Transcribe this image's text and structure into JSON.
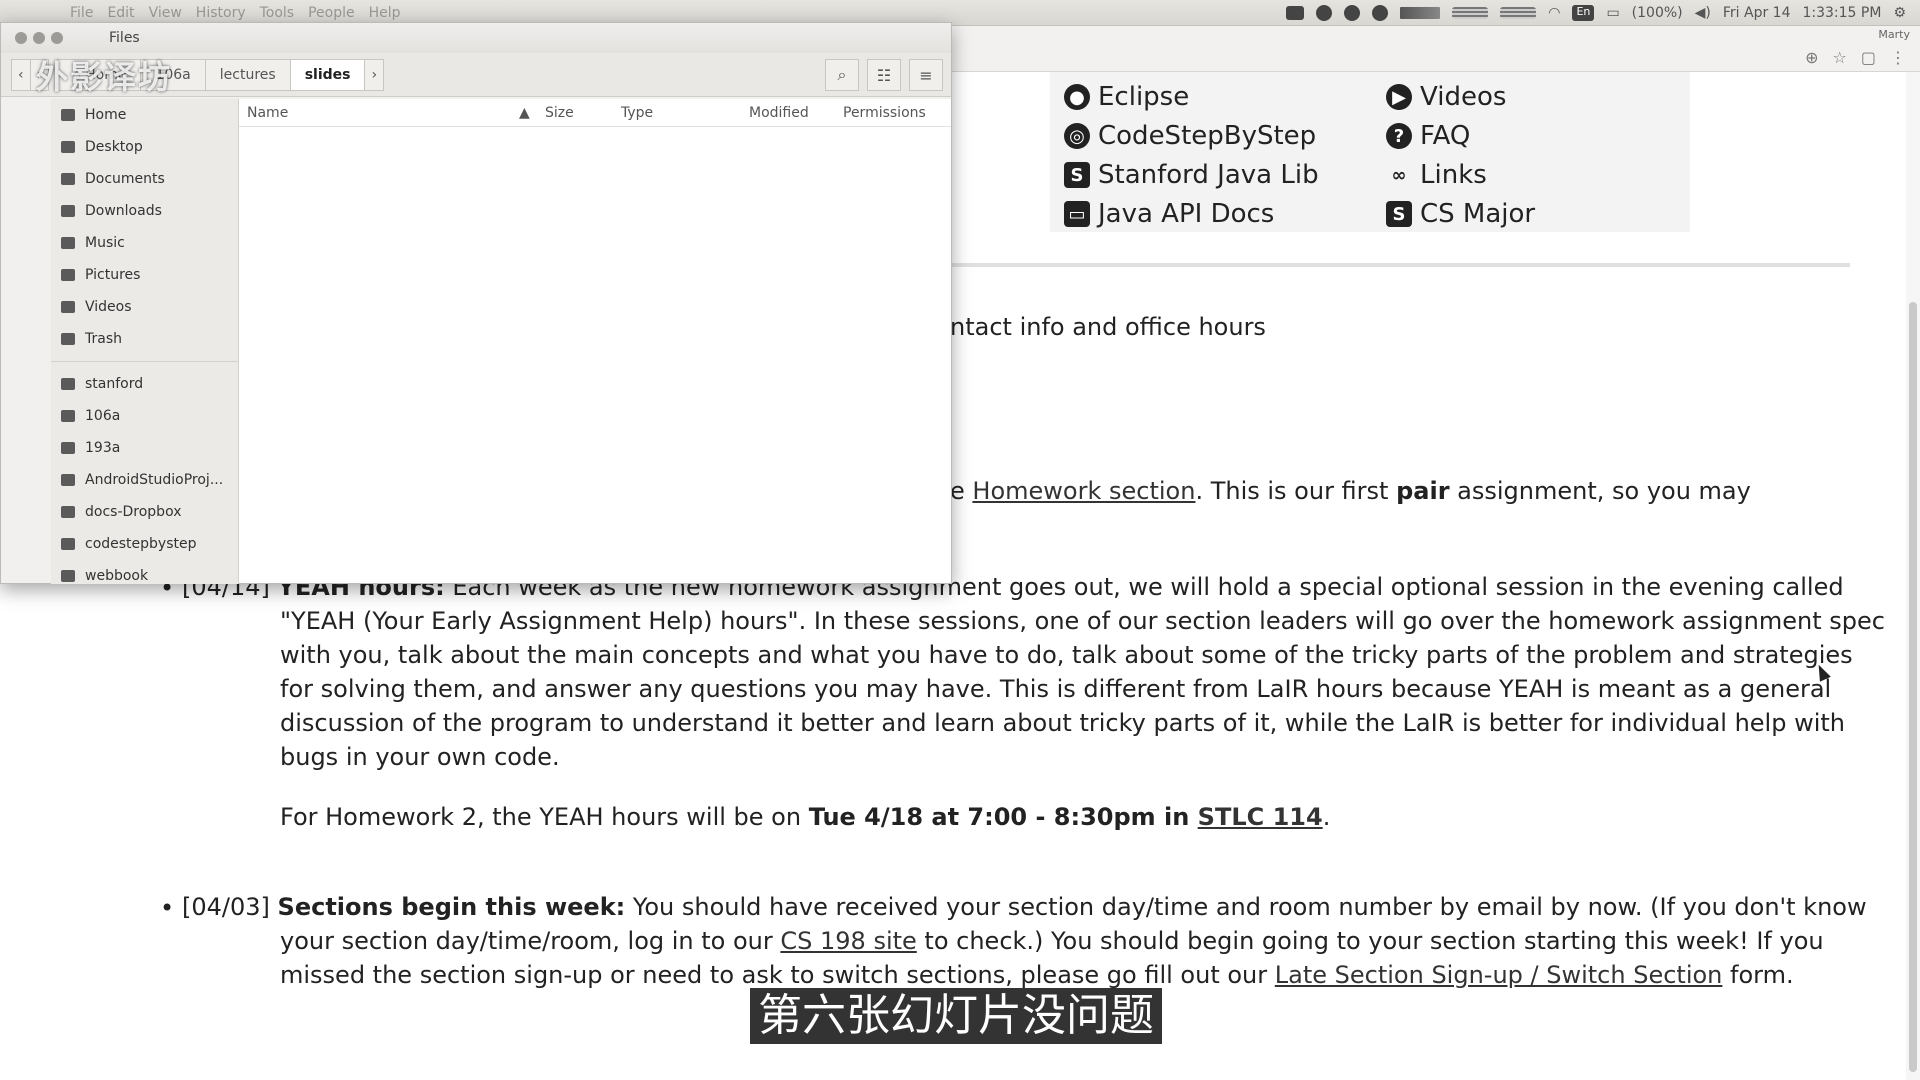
{
  "menubar": {
    "items": [
      "File",
      "Edit",
      "View",
      "History",
      "Tools",
      "People",
      "Help"
    ],
    "battery": "(100%)",
    "date": "Fri Apr 14",
    "time": "1:33:15 PM",
    "lang": "En"
  },
  "browser": {
    "user": "Marty"
  },
  "files": {
    "title": "Files",
    "breadcrumbs": [
      "Home",
      "106a",
      "lectures",
      "slides"
    ],
    "sidebar_places": [
      "Home",
      "Desktop",
      "Documents",
      "Downloads",
      "Music",
      "Pictures",
      "Videos",
      "Trash"
    ],
    "sidebar_bookmarks": [
      "stanford",
      "106a",
      "193a",
      "AndroidStudioProj...",
      "docs-Dropbox",
      "codestepbystep",
      "webbook"
    ],
    "columns": [
      "Name",
      "Size",
      "Type",
      "Modified",
      "Permissions"
    ]
  },
  "nav": {
    "left": [
      "Eclipse",
      "CodeStepByStep",
      "Stanford Java Lib",
      "Java API Docs"
    ],
    "right": [
      "Videos",
      "FAQ",
      "Links",
      "CS Major"
    ]
  },
  "content": {
    "contact_fragment": "ntact info and office hours",
    "hw_prefix": "e ",
    "hw_link": "Homework section",
    "hw_mid": ". This is our first ",
    "hw_bold": "pair",
    "hw_tail": " assignment, so you may",
    "yeah_date": "[04/14] ",
    "yeah_title": "YEAH hours:",
    "yeah_line1": " Each week as the new homework assignment goes out, we will hold a special optional session in the evening called",
    "yeah_line2": "\"YEAH (Your Early Assignment Help) hours\". In these sessions, one of our section leaders will go over the homework assignment spec",
    "yeah_line3": "with you, talk about the main concepts and what you have to do, talk about some of the tricky parts of the problem and strategies",
    "yeah_line4": "for solving them, and answer any questions you may have. This is different from LaIR hours because YEAH is meant as a general",
    "yeah_line5": "discussion of the program to understand it better and learn about tricky parts of it, while the LaIR is better for individual help with",
    "yeah_line6": "bugs in your own code.",
    "hw2_prefix": "For Homework 2, the YEAH hours will be on ",
    "hw2_bold": "Tue 4/18 at 7:00 - 8:30pm in ",
    "hw2_link": "STLC 114",
    "hw2_end": ".",
    "sec_date": "[04/03] ",
    "sec_title": "Sections begin this week:",
    "sec_line1": " You should have received your section day/time and room number by email by now. (If you don't know",
    "sec_line2a": "your section day/time/room, log in to our ",
    "sec_link1": "CS 198 site",
    "sec_line2b": " to check.) You should begin going to your section starting this week! If you",
    "sec_line3a": "missed the section sign-up or need to ask to switch sections, please go fill out our ",
    "sec_link2": "Late Section Sign-up / Switch Section",
    "sec_line3b": " form."
  },
  "overlay": {
    "watermark": "外影译坊",
    "subtitle": "第六张幻灯片没问题"
  }
}
